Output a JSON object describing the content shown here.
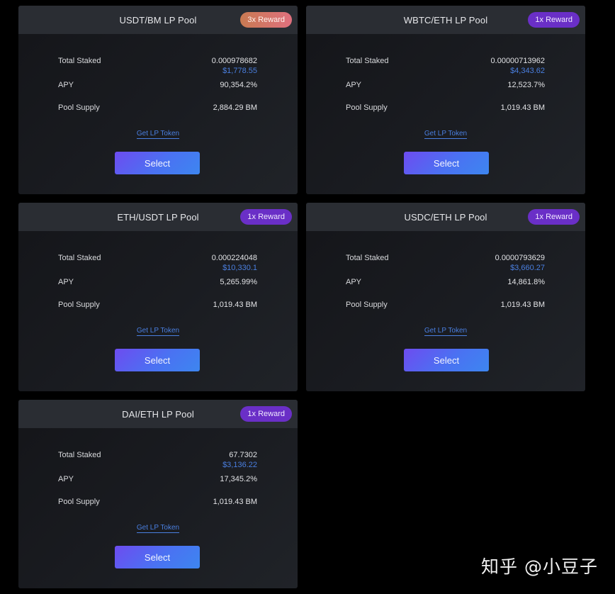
{
  "pools": [
    {
      "title": "USDT/BM LP Pool",
      "reward": "3x Reward",
      "reward_style": "hot",
      "total_staked_label": "Total Staked",
      "total_staked": "0.000978682",
      "total_staked_usd": "$1,778.55",
      "apy_label": "APY",
      "apy": "90,354.2%",
      "supply_label": "Pool Supply",
      "supply": "2,884.29 BM",
      "lp_link": "Get LP Token",
      "button": "Select"
    },
    {
      "title": "WBTC/ETH LP Pool",
      "reward": "1x Reward",
      "reward_style": "normal",
      "total_staked_label": "Total Staked",
      "total_staked": "0.00000713962",
      "total_staked_usd": "$4,343.62",
      "apy_label": "APY",
      "apy": "12,523.7%",
      "supply_label": "Pool Supply",
      "supply": "1,019.43 BM",
      "lp_link": "Get LP Token",
      "button": "Select"
    },
    {
      "title": "ETH/USDT LP Pool",
      "reward": "1x Reward",
      "reward_style": "normal",
      "total_staked_label": "Total Staked",
      "total_staked": "0.000224048",
      "total_staked_usd": "$10,330.1",
      "apy_label": "APY",
      "apy": "5,265.99%",
      "supply_label": "Pool Supply",
      "supply": "1,019.43 BM",
      "lp_link": "Get LP Token",
      "button": "Select"
    },
    {
      "title": "USDC/ETH LP Pool",
      "reward": "1x Reward",
      "reward_style": "normal",
      "total_staked_label": "Total Staked",
      "total_staked": "0.0000793629",
      "total_staked_usd": "$3,660.27",
      "apy_label": "APY",
      "apy": "14,861.8%",
      "supply_label": "Pool Supply",
      "supply": "1,019.43 BM",
      "lp_link": "Get LP Token",
      "button": "Select"
    },
    {
      "title": "DAI/ETH LP Pool",
      "reward": "1x Reward",
      "reward_style": "normal",
      "total_staked_label": "Total Staked",
      "total_staked": "67.7302",
      "total_staked_usd": "$3,136.22",
      "apy_label": "APY",
      "apy": "17,345.2%",
      "supply_label": "Pool Supply",
      "supply": "1,019.43 BM",
      "lp_link": "Get LP Token",
      "button": "Select"
    }
  ],
  "watermark": "知乎 @小豆子",
  "colors": {
    "page_background": "#000000",
    "card_header": "#2a2d33",
    "usd_value": "#4a7fe0",
    "reward_badge": "#6a2fc7",
    "reward_badge_hot": "#d47468",
    "select_button": "#4a72f2"
  }
}
